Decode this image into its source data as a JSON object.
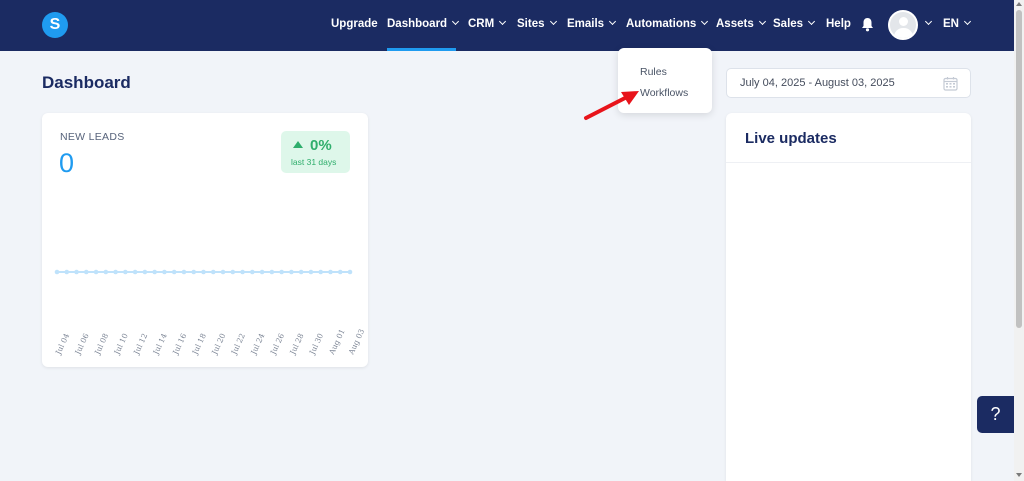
{
  "app": {
    "logo_letter": "S"
  },
  "nav": {
    "items": [
      {
        "label": "Upgrade",
        "has_menu": false
      },
      {
        "label": "Dashboard",
        "has_menu": true
      },
      {
        "label": "CRM",
        "has_menu": true
      },
      {
        "label": "Sites",
        "has_menu": true
      },
      {
        "label": "Emails",
        "has_menu": true
      },
      {
        "label": "Automations",
        "has_menu": true
      },
      {
        "label": "Assets",
        "has_menu": true
      },
      {
        "label": "Sales",
        "has_menu": true
      },
      {
        "label": "Help",
        "has_menu": false
      }
    ],
    "active": "Dashboard",
    "language": "EN"
  },
  "automations_menu": {
    "items": [
      "Rules",
      "Workflows"
    ]
  },
  "page": {
    "title": "Dashboard"
  },
  "date_range": {
    "value": "July 04, 2025 - August 03, 2025"
  },
  "leads": {
    "label": "NEW LEADS",
    "value": "0",
    "change": "0%",
    "change_period": "last 31 days"
  },
  "chart_data": {
    "type": "line",
    "x": [
      "Jul 04",
      "Jul 06",
      "Jul 08",
      "Jul 10",
      "Jul 12",
      "Jul 14",
      "Jul 16",
      "Jul 18",
      "Jul 20",
      "Jul 22",
      "Jul 24",
      "Jul 26",
      "Jul 28",
      "Jul 30",
      "Aug 01",
      "Aug 03"
    ],
    "series": [
      {
        "values": [
          0,
          0,
          0,
          0,
          0,
          0,
          0,
          0,
          0,
          0,
          0,
          0,
          0,
          0,
          0,
          0,
          0,
          0,
          0,
          0,
          0,
          0,
          0,
          0,
          0,
          0,
          0,
          0,
          0,
          0,
          0
        ]
      }
    ],
    "points": 31
  },
  "live_updates": {
    "title": "Live updates"
  },
  "help": {
    "label": "?"
  },
  "colors": {
    "nav_bg": "#1b2b62",
    "accent": "#1f9bf0",
    "success": "#2fae6c",
    "annotation_arrow": "#e8141b"
  }
}
